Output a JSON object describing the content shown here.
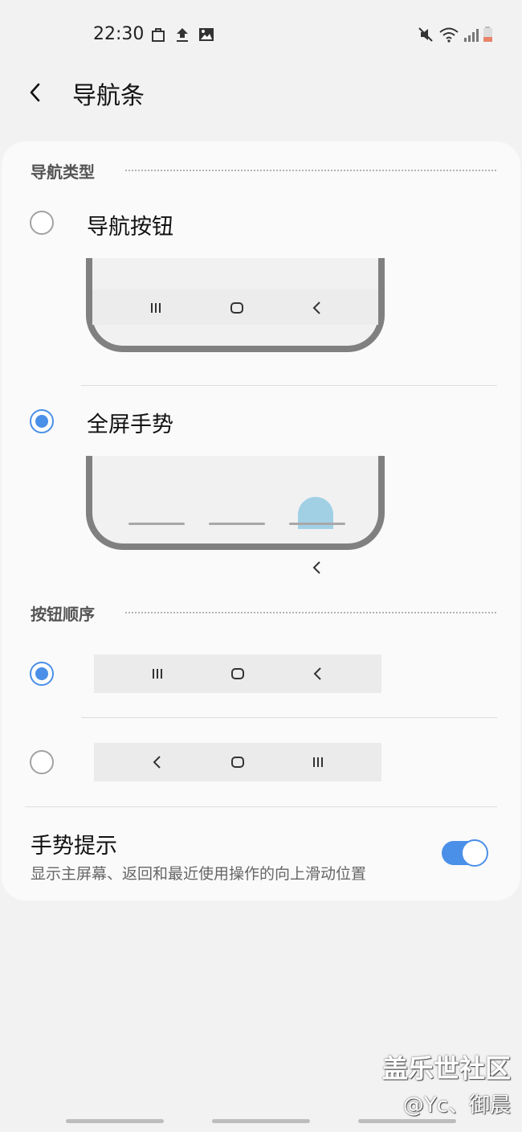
{
  "status_bar": {
    "time": "22:30",
    "left_icons": [
      "bag-icon",
      "upload-icon",
      "image-icon"
    ],
    "right_icons": [
      "mute-icon",
      "wifi-icon",
      "signal-icon",
      "battery-icon"
    ],
    "battery_color": "#e8836a"
  },
  "header": {
    "title": "导航条"
  },
  "nav_type_section": {
    "header": "导航类型",
    "options": [
      {
        "label": "导航按钮",
        "selected": false
      },
      {
        "label": "全屏手势",
        "selected": true
      }
    ]
  },
  "button_order_section": {
    "header": "按钮顺序",
    "options": [
      {
        "order": [
          "recents-icon",
          "home-icon",
          "back-icon"
        ],
        "selected": true
      },
      {
        "order": [
          "back-icon",
          "home-icon",
          "recents-icon"
        ],
        "selected": false
      }
    ]
  },
  "gesture_hint": {
    "title": "手势提示",
    "description": "显示主屏幕、返回和最近使用操作的向上滑动位置",
    "enabled": true
  },
  "watermark": {
    "line1": "盖乐世社区",
    "line2": "@Yc、御晨"
  },
  "accent_color": "#4a8fe8"
}
